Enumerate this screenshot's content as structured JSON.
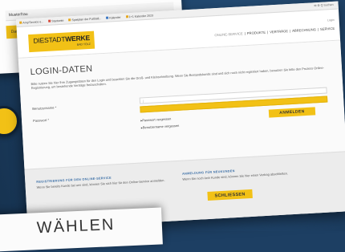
{
  "back_sheet": {
    "bar_text": "Musterfrau",
    "yellow_text": "Dat..."
  },
  "browser": {
    "bookmarks": [
      {
        "label": "Amp'Service e...",
        "icon": "bookmark-icon"
      },
      {
        "label": "Startseite",
        "icon": "bookmark-icon"
      },
      {
        "label": "Spielplan der Fußball...",
        "icon": "bookmark-icon"
      },
      {
        "label": "Kalender",
        "icon": "bookmark-icon"
      },
      {
        "label": "1+1 Kalender 2023",
        "icon": "bookmark-icon"
      }
    ],
    "util": "✉  ⚙  Q  Suchen"
  },
  "header": {
    "logo_prefix": "DIESTADT",
    "logo_bold": "WERKE",
    "logo_sub": "BAD TÖLZ",
    "login_link": "Login",
    "nav": [
      "ONLINE-SERVICE",
      "PRODUKTE",
      "VERTRÄGE",
      "ABRECHNUNG",
      "SERVICE"
    ],
    "nav_sep": "|"
  },
  "login": {
    "title": "LOGIN-DATEN",
    "intro": "Bitte nutzen Sie hier Ihre Zugangsdaten für den Login und beachten Sie die Groß- und Kleinschreibung. Wenn Sie Bestandskunde sind und sich noch nicht registriert haben, benutzen Sie bitte den Prozess Online-Registrierung, um bestehende Verträge freizuschalten.",
    "username_label": "Benutzername *",
    "password_label": "Passwort *",
    "username_value": "|",
    "forgot_password": "Passwort vergessen",
    "forgot_username": "Benutzername vergessen",
    "submit": "ANMELDEN"
  },
  "lower": {
    "registration_title": "REGISTRIERUNG FÜR DEN ONLINE-SERVICE",
    "registration_text": "Wenn Sie bereits Kunde bei uns sind, können Sie sich hier für den Online-Service anmelden.",
    "newcustomer_title": "ANMELDUNG FÜR NEUKUNDEN",
    "newcustomer_text": "Wenn Sie noch kein Kunde sind, können Sie hier einen Vertrag abschließen.",
    "close_button": "SCHLIESSEN"
  },
  "bottom_card": {
    "text": "WÄHLEN"
  }
}
